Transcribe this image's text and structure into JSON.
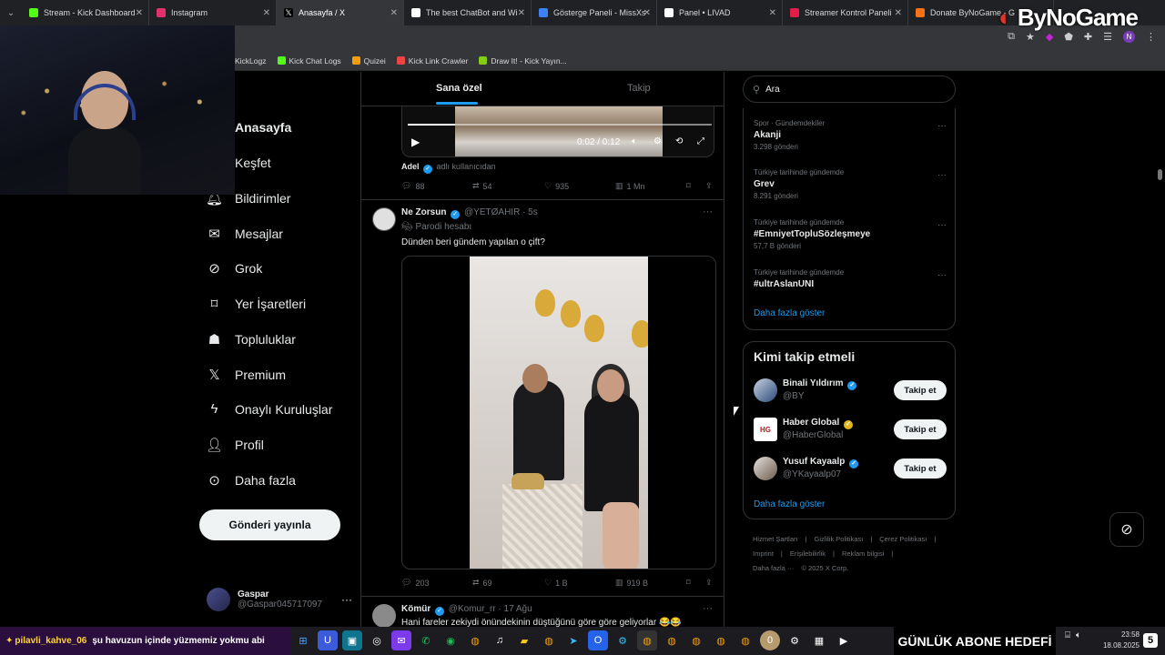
{
  "browser": {
    "tabs": [
      {
        "label": "Stream - Kick Dashboard",
        "color": "#53fc18",
        "active": false
      },
      {
        "label": "Instagram",
        "color": "#e1306c",
        "active": false
      },
      {
        "label": "Anasayfa / X",
        "color": "#ffffff",
        "active": true
      },
      {
        "label": "The best ChatBot and Wi",
        "color": "#ffffff",
        "active": false
      },
      {
        "label": "Gösterge Paneli - MissXs",
        "color": "#3b82f6",
        "active": false
      },
      {
        "label": "Panel • LIVAD",
        "color": "#ffffff",
        "active": false
      },
      {
        "label": "Streamer Kontrol Paneli",
        "color": "#e11d48",
        "active": false
      },
      {
        "label": "Donate ByNoGame - G",
        "color": "#f97316",
        "active": false
      }
    ],
    "bookmarks": [
      {
        "label": "KickLogz",
        "color": ""
      },
      {
        "label": "Kick Chat Logs",
        "color": "#53fc18"
      },
      {
        "label": "Quizei",
        "color": "#f59e0b"
      },
      {
        "label": "Kick Link Crawler",
        "color": "#ef4444"
      },
      {
        "label": "Draw It! - Kick Yayın...",
        "color": "#84cc16"
      }
    ],
    "profile_initial": "N"
  },
  "overlay": {
    "brand_prefix": "By",
    "brand_rest": "NoGame"
  },
  "nav": {
    "items": [
      {
        "label": "Anasayfa",
        "icon": "home-icon"
      },
      {
        "label": "Keşfet",
        "icon": "search-icon"
      },
      {
        "label": "Bildirimler",
        "icon": "bell-icon"
      },
      {
        "label": "Mesajlar",
        "icon": "mail-icon"
      },
      {
        "label": "Grok",
        "icon": "grok-icon"
      },
      {
        "label": "Yer İşaretleri",
        "icon": "bookmark-icon"
      },
      {
        "label": "Topluluklar",
        "icon": "communities-icon"
      },
      {
        "label": "Premium",
        "icon": "x-logo-icon"
      },
      {
        "label": "Onaylı Kuruluşlar",
        "icon": "lightning-icon"
      },
      {
        "label": "Profil",
        "icon": "person-icon"
      },
      {
        "label": "Daha fazla",
        "icon": "more-circle-icon"
      }
    ],
    "post_button": "Gönderi yayınla",
    "account": {
      "name": "Gaspar",
      "handle": "@Gaspar045717097"
    }
  },
  "feed": {
    "tabs": [
      "Sana özel",
      "Takip"
    ],
    "tweet1": {
      "video_time": "0:02 / 0:12",
      "author": "Adel",
      "author_suffix": "adlı kullanıcıdan",
      "replies": "88",
      "retweets": "54",
      "likes": "935",
      "views": "1 Mn"
    },
    "tweet2": {
      "name": "Ne Zorsun",
      "handle": "@YETØAHIR",
      "time": "· 5s",
      "parody": "Parodi hesabı",
      "text": "Dünden beri gündem yapılan o çift?",
      "replies": "203",
      "retweets": "69",
      "likes": "1 B",
      "views": "919 B"
    },
    "tweet3": {
      "name": "Kömür",
      "handle": "@Komur_rr",
      "time": "· 17 Ağu",
      "text": "Hani fareler zekiydi önündekinin düştüğünü göre göre geliyorlar 😂😂"
    }
  },
  "right": {
    "search_placeholder": "Ara",
    "trends": [
      {
        "context": "Spor · Gündemdekiler",
        "title": "Akanji",
        "count": "3.298 gönderi"
      },
      {
        "context": "Türkiye tarihinde gündemde",
        "title": "Grev",
        "count": "8.291 gönderi"
      },
      {
        "context": "Türkiye tarihinde gündemde",
        "title": "#EmniyetTopluSözleşmeye",
        "count": "57,7 B gönderi"
      },
      {
        "context": "Türkiye tarihinde gündemde",
        "title": "#ultrAslanUNI",
        "count": ""
      }
    ],
    "show_more": "Daha fazla göster",
    "who_to_follow": {
      "title": "Kimi takip etmeli",
      "items": [
        {
          "name": "Binali Yıldırım",
          "handle": "@BY",
          "verified": "blue"
        },
        {
          "name": "Haber Global",
          "handle": "@HaberGlobal",
          "verified": "gold"
        },
        {
          "name": "Yusuf Kayaalp",
          "handle": "@YKayaalp07",
          "verified": "blue"
        }
      ],
      "follow_label": "Takip et",
      "show_more": "Daha fazla göster"
    },
    "footer": {
      "line1": [
        "Hizmet Şartları",
        "|",
        "Gizlilik Politikası",
        "|",
        "Çerez Politikası",
        "|"
      ],
      "line2": [
        "Imprint",
        "|",
        "Erişilebilirlik",
        "|",
        "Reklam bilgisi",
        "|"
      ],
      "line3": [
        "Daha fazla ···",
        "© 2025 X Corp."
      ]
    }
  },
  "taskbar": {
    "chat_user": "pilavli_kahve_06",
    "chat_message": "şu havuzun içinde yüzmemiz yokmu abi",
    "goal": "GÜNLÜK ABONE HEDEFİ",
    "badge_count": "0",
    "time": "23:58",
    "date": "18.08.2025",
    "notif": "5"
  },
  "colors": {
    "accent": "#1d9bf0",
    "background": "#000000",
    "border": "#2f3336",
    "muted": "#71767b"
  }
}
